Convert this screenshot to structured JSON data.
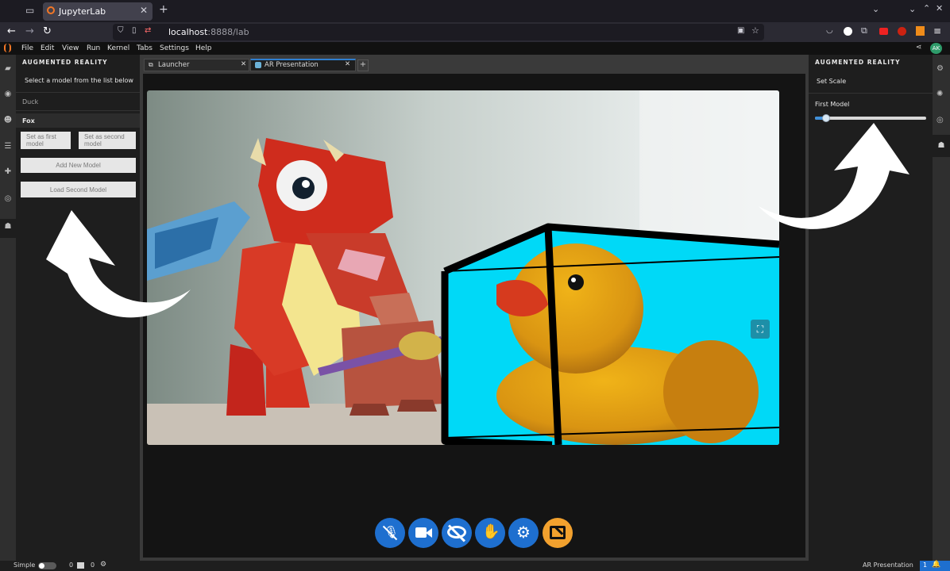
{
  "browser": {
    "tab_title": "JupyterLab",
    "url_host": "localhost",
    "url_rest": ":8888/lab"
  },
  "menu": [
    "File",
    "Edit",
    "View",
    "Run",
    "Kernel",
    "Tabs",
    "Settings",
    "Help"
  ],
  "user_initials": "AK",
  "left_panel": {
    "header": "AUGMENTED REALITY",
    "instruction": "Select a model from the list below",
    "models": [
      "Duck",
      "Fox"
    ],
    "set_first_label": "Set as first model",
    "set_second_label": "Set as second model",
    "add_model_label": "Add New Model",
    "load_second_label": "Load Second Model"
  },
  "doc_tabs": [
    {
      "label": "Launcher"
    },
    {
      "label": "AR Presentation"
    }
  ],
  "controls": [
    "mic-off-icon",
    "camera-icon",
    "eye-off-icon",
    "raise-hand-icon",
    "settings-icon",
    "exit-ar-icon"
  ],
  "right_panel": {
    "header": "AUGMENTED REALITY",
    "section": "Set Scale",
    "slider_label": "First Model",
    "slider_value": 0.1
  },
  "status": {
    "mode_label": "Simple",
    "kernels": "0",
    "terminals": "0",
    "doc_name": "AR Presentation",
    "notifications": "1"
  },
  "colors": {
    "accent_blue": "#1e6fcf",
    "exit_orange": "#f2a12e",
    "box_cyan": "#00d9f7"
  }
}
